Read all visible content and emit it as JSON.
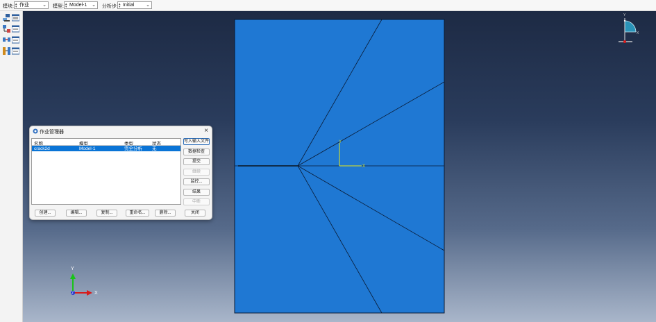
{
  "context_bar": {
    "module_label": "模块:",
    "module_value": "作业",
    "model_label": "模型:",
    "model_value": "Model-1",
    "step_label": "分析步:",
    "step_value": "Initial"
  },
  "toolbox": {
    "tools": [
      "create-job-icon",
      "job-manager-icon",
      "adaptivity-icon",
      "co-execution-icon",
      "optimization-icon",
      "optimization-manager-icon"
    ]
  },
  "viewport": {
    "background_top": "#1d2a44",
    "background_bottom": "#a9b6ca",
    "part_color": "#1f78d3",
    "edge_color": "#0a1a33",
    "csys_x_label": "X",
    "csys_y_label": "Y",
    "triad_x_label": "X",
    "triad_y_label": "Y",
    "triad_z_label": "Z",
    "view_cube_y_label": "Y",
    "view_cube_x_label": "X"
  },
  "job_manager": {
    "title": "作业管理器",
    "columns": [
      "名称",
      "模型",
      "类型",
      "状态"
    ],
    "rows": [
      {
        "name": "crack2d",
        "model": "Model-1",
        "type": "完全分析",
        "status": "无"
      }
    ],
    "side_buttons": [
      {
        "label": "写入输入文件",
        "enabled": true
      },
      {
        "label": "数据检查",
        "enabled": true
      },
      {
        "label": "提交",
        "enabled": true
      },
      {
        "label": "继续",
        "enabled": false
      },
      {
        "label": "监控...",
        "enabled": true
      },
      {
        "label": "结果",
        "enabled": true
      },
      {
        "label": "中断",
        "enabled": false
      }
    ],
    "bottom_buttons": [
      "创建...",
      "编辑...",
      "复制...",
      "重命名...",
      "删除...",
      "关闭"
    ],
    "selection_color": "#0a74d6"
  }
}
